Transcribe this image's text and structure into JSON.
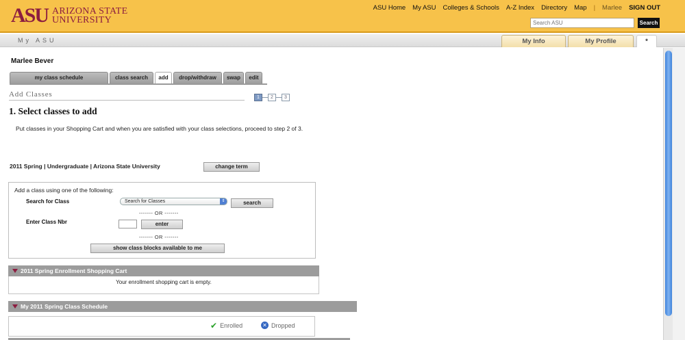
{
  "header": {
    "logo_mark": "ASU",
    "logo_line1": "ARIZONA STATE",
    "logo_line2": "UNIVERSITY",
    "nav": [
      "ASU Home",
      "My ASU",
      "Colleges & Schools",
      "A-Z Index",
      "Directory",
      "Map"
    ],
    "user": "Marlee",
    "signout": "SIGN OUT",
    "search_placeholder": "Search ASU",
    "search_button": "Search"
  },
  "subbar": {
    "title": "My ASU",
    "tabs": [
      "My Info",
      "My Profile",
      "*"
    ]
  },
  "content": {
    "username": "Marlee Bever",
    "tabs": [
      "my class schedule",
      "class search",
      "add",
      "drop/withdraw",
      "swap",
      "edit"
    ],
    "active_tab": "add",
    "section_title": "Add Classes",
    "steps": [
      "1",
      "2",
      "3"
    ],
    "step_heading": "1.  Select classes to add",
    "instructions": "Put classes in your Shopping Cart and when you are satisfied with your class selections, proceed to step 2 of 3.",
    "term": "2011 Spring | Undergraduate | Arizona State University",
    "change_term": "change term",
    "add_box": {
      "intro": "Add a class using one of the following:",
      "search_label": "Search for Class",
      "select_value": "Search for Classes",
      "search_button": "search",
      "or1": "------- OR -------",
      "nbr_label": "Enter Class Nbr",
      "enter_button": "enter",
      "or2": "------- OR -------",
      "blocks_button": "show class blocks available to me"
    },
    "cart": {
      "title": "2011 Spring Enrollment Shopping Cart",
      "empty": "Your enrollment shopping cart is empty."
    },
    "schedule": {
      "title": "My 2011 Spring Class Schedule",
      "enrolled": "Enrolled",
      "dropped": "Dropped"
    }
  },
  "colors": {
    "header_bg": "#f7c24a",
    "brand_maroon": "#8c1d40",
    "panel_gray": "#9c9c9c"
  }
}
